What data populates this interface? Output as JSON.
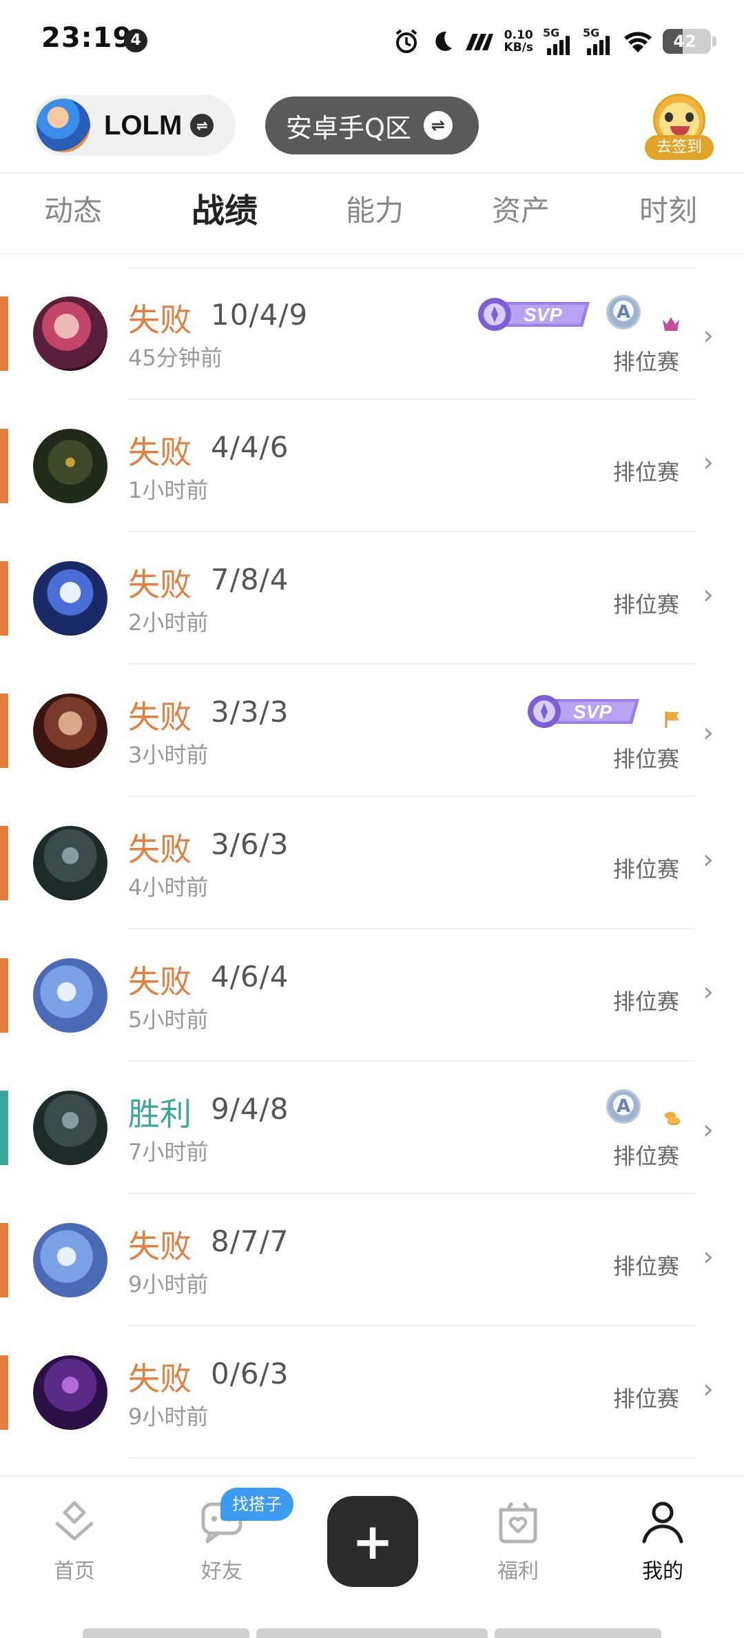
{
  "status_bar": {
    "time": "23:19",
    "notification_count": "4",
    "net_speed_top": "0.10",
    "net_speed_bottom": "KB/s",
    "signal_1": "5G",
    "signal_2": "5G",
    "battery": "42",
    "battery_level": 0.42,
    "icons": [
      "alarm-icon",
      "moon-icon",
      "carrier-icon",
      "wifi-icon"
    ]
  },
  "header": {
    "game_name": "LOLM",
    "server_name": "安卓手Q区",
    "checkin_label": "去签到"
  },
  "tabs": [
    {
      "label": "动态",
      "active": false
    },
    {
      "label": "战绩",
      "active": true
    },
    {
      "label": "能力",
      "active": false
    },
    {
      "label": "资产",
      "active": false
    },
    {
      "label": "时刻",
      "active": false
    }
  ],
  "colors": {
    "loss": "#e07f3e",
    "win": "#3aa79a",
    "svp_purple": "#8a6ad8"
  },
  "matches": [
    {
      "result": "失败",
      "kda": "10/4/9",
      "time_ago": "45分钟前",
      "mode": "排位赛",
      "svp": true,
      "a_badge": true,
      "extra_icon": "crown-icon",
      "outcome": "loss",
      "hero_icon": "hero-vi-icon"
    },
    {
      "result": "失败",
      "kda": "4/4/6",
      "time_ago": "1小时前",
      "mode": "排位赛",
      "svp": false,
      "a_badge": false,
      "extra_icon": "",
      "outcome": "loss",
      "hero_icon": "hero-warwick-icon"
    },
    {
      "result": "失败",
      "kda": "7/8/4",
      "time_ago": "2小时前",
      "mode": "排位赛",
      "svp": false,
      "a_badge": false,
      "extra_icon": "",
      "outcome": "loss",
      "hero_icon": "hero-kindred-icon"
    },
    {
      "result": "失败",
      "kda": "3/3/3",
      "time_ago": "3小时前",
      "mode": "排位赛",
      "svp": true,
      "a_badge": false,
      "extra_icon": "flag-icon",
      "outcome": "loss",
      "hero_icon": "hero-darius-icon"
    },
    {
      "result": "失败",
      "kda": "3/6/3",
      "time_ago": "4小时前",
      "mode": "排位赛",
      "svp": false,
      "a_badge": false,
      "extra_icon": "",
      "outcome": "loss",
      "hero_icon": "hero-mordekaiser-icon"
    },
    {
      "result": "失败",
      "kda": "4/6/4",
      "time_ago": "5小时前",
      "mode": "排位赛",
      "svp": false,
      "a_badge": false,
      "extra_icon": "",
      "outcome": "loss",
      "hero_icon": "hero-fizz-icon"
    },
    {
      "result": "胜利",
      "kda": "9/4/8",
      "time_ago": "7小时前",
      "mode": "排位赛",
      "svp": false,
      "a_badge": true,
      "extra_icon": "coins-icon",
      "outcome": "win",
      "hero_icon": "hero-mordekaiser-icon"
    },
    {
      "result": "失败",
      "kda": "8/7/7",
      "time_ago": "9小时前",
      "mode": "排位赛",
      "svp": false,
      "a_badge": false,
      "extra_icon": "",
      "outcome": "loss",
      "hero_icon": "hero-fizz-icon"
    },
    {
      "result": "失败",
      "kda": "0/6/3",
      "time_ago": "9小时前",
      "mode": "排位赛",
      "svp": false,
      "a_badge": false,
      "extra_icon": "",
      "outcome": "loss",
      "hero_icon": "hero-evelynn-icon"
    }
  ],
  "svp_label": "SVP",
  "a_label": "A",
  "bottom_nav": {
    "items": [
      {
        "label": "首页",
        "icon": "home-icon",
        "active": false
      },
      {
        "label": "好友",
        "icon": "chat-icon",
        "active": false
      },
      {
        "label": "福利",
        "icon": "gift-heart-icon",
        "active": false
      },
      {
        "label": "我的",
        "icon": "user-icon",
        "active": true
      }
    ],
    "friend_badge": "找搭子",
    "fab_symbol": "+"
  }
}
